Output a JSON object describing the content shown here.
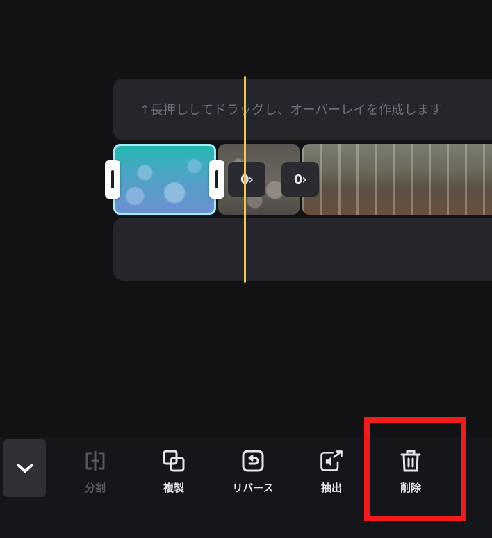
{
  "timeline": {
    "overlay_hint": "↑長押ししてドラッグし、オーバーレイを作成します",
    "transitions": [
      {
        "icon": "transition-icon",
        "label": "0›"
      },
      {
        "icon": "transition-icon",
        "label": "0›"
      }
    ]
  },
  "toolbar": {
    "collapse_icon": "chevron-down-icon",
    "tools": [
      {
        "label": "分割",
        "icon": "split-icon",
        "enabled": false
      },
      {
        "label": "複製",
        "icon": "duplicate-icon",
        "enabled": true
      },
      {
        "label": "リバース",
        "icon": "reverse-icon",
        "enabled": true
      },
      {
        "label": "抽出",
        "icon": "extract-audio-icon",
        "enabled": true
      },
      {
        "label": "削除",
        "icon": "trash-icon",
        "enabled": true,
        "highlighted": true
      }
    ]
  },
  "colors": {
    "background": "#121214",
    "track": "#25262b",
    "playhead": "#f3c747",
    "selected_clip_border": "#9ff0f5",
    "highlight": "#f21b1b"
  }
}
